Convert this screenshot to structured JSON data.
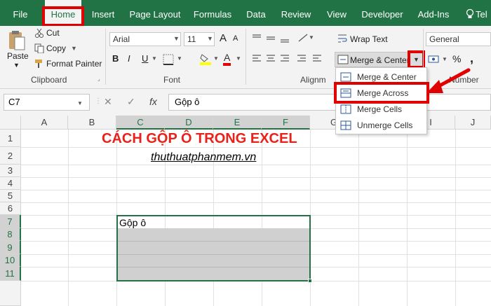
{
  "tabs": [
    "File",
    "Home",
    "Insert",
    "Page Layout",
    "Formulas",
    "Data",
    "Review",
    "View",
    "Developer",
    "Add-Ins",
    "Tel"
  ],
  "clipboard": {
    "paste": "Paste",
    "cut": "Cut",
    "copy": "Copy",
    "format_painter": "Format Painter",
    "label": "Clipboard"
  },
  "font": {
    "name": "Arial",
    "size": "11",
    "label": "Font",
    "bold": "B",
    "italic": "I",
    "underline": "U",
    "grow": "A",
    "shrink": "A",
    "color_a": "A"
  },
  "alignment": {
    "wrap_text": "Wrap Text",
    "merge_center": "Merge & Center",
    "label_partial": "Alignm"
  },
  "number": {
    "format": "General",
    "label": "Number",
    "percent": "%",
    "comma": ","
  },
  "merge_menu": [
    "Merge & Center",
    "Merge Across",
    "Merge Cells",
    "Unmerge Cells"
  ],
  "formula_bar": {
    "name_box": "C7",
    "fx": "fx",
    "cancel": "✕",
    "enter": "✓",
    "value": "Gộp ô"
  },
  "columns": [
    "A",
    "B",
    "C",
    "D",
    "E",
    "F",
    "G",
    "H",
    "I",
    "J"
  ],
  "rows": [
    "1",
    "2",
    "3",
    "4",
    "5",
    "6",
    "7",
    "8",
    "9",
    "10",
    "11"
  ],
  "cells": {
    "title": "CÁCH GỘP Ô TRONG EXCEL",
    "subtitle": "thuthuatphanmem.vn",
    "c7": "Gộp ô"
  },
  "colors": {
    "excel_green": "#217346",
    "highlight_red": "#e00000",
    "title_red": "#e8221b",
    "selection_gray": "#d0d0d0"
  }
}
